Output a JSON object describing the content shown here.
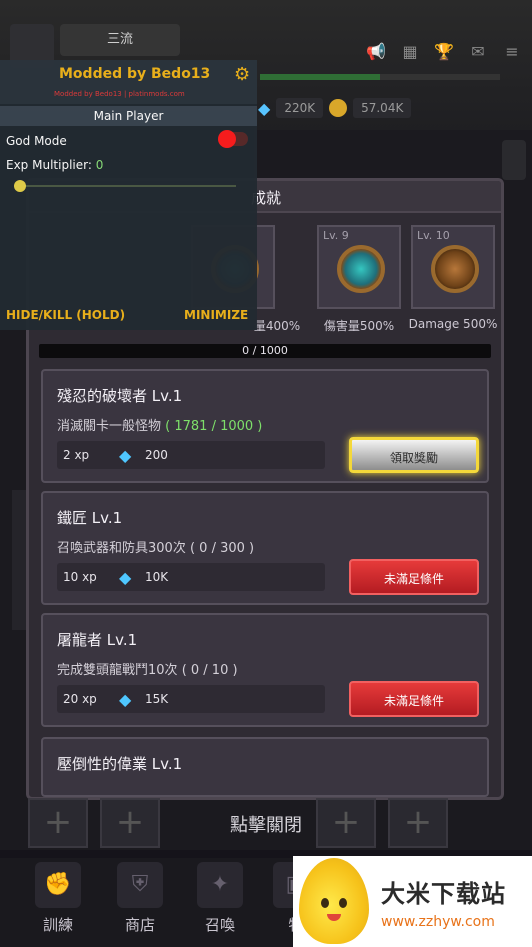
{
  "header": {
    "title_tab": "三流",
    "currency": {
      "gems": "220K",
      "gold": "57.04K"
    }
  },
  "panel": {
    "title": "成就",
    "tiers": [
      {
        "level": "",
        "caption": "量400%"
      },
      {
        "level": "Lv. 9",
        "caption": "傷害量500%"
      },
      {
        "level": "Lv. 10",
        "caption": "Damage 500%"
      }
    ],
    "progress_text": "0 / 1000"
  },
  "achievements": [
    {
      "name": "殘忍的破壞者 Lv.1",
      "desc": "消滅關卡一般怪物",
      "progress": "( 1781 / 1000 )",
      "xp": "2 xp",
      "gems": "200",
      "button": "領取獎勵"
    },
    {
      "name": "鐵匠 Lv.1",
      "desc": "召喚武器和防具300次",
      "progress": "( 0 / 300 )",
      "xp": "10 xp",
      "gems": "10K",
      "button": "未滿足條件"
    },
    {
      "name": "屠龍者 Lv.1",
      "desc": "完成雙頭龍戰鬥10次",
      "progress": "( 0 / 10 )",
      "xp": "20 xp",
      "gems": "15K",
      "button": "未滿足條件"
    },
    {
      "name": "壓倒性的偉業 Lv.1"
    }
  ],
  "close_tip": "點擊關閉",
  "bottom_nav": [
    "訓練",
    "商店",
    "召喚",
    "物"
  ],
  "mod_menu": {
    "title": "Modded by Bedo13",
    "subtitle": "Modded by Bedo13 | platinmods.com",
    "section": "Main Player",
    "god_mode_label": "God Mode",
    "exp_label": "Exp Multiplier:",
    "exp_value": "0",
    "exp_slider_fraction": 0,
    "god_mode_on": false,
    "hide_label": "HIDE/KILL (HOLD)",
    "minimize_label": "MINIMIZE"
  },
  "watermark": {
    "name": "大米下载站",
    "url": "www.zzhyw.com"
  },
  "colors": {
    "mod_accent": "#f0b51b",
    "danger_red": "#e63a3a",
    "gem": "#4fc7ff",
    "complete_green": "#7ee06a"
  }
}
